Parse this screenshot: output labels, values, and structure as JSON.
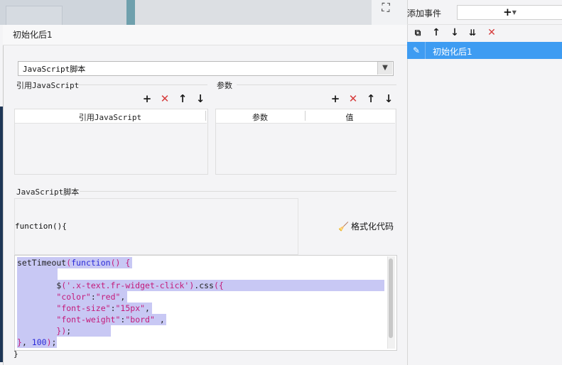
{
  "dialog": {
    "title": "初始化后1",
    "script_type_select": {
      "value": "JavaScript脚本"
    },
    "referenced_js": {
      "section_label": "引用JavaScript",
      "column_header": "引用JavaScript"
    },
    "params": {
      "section_label": "参数",
      "columns": [
        "参数",
        "值"
      ]
    },
    "js_section_label": "JavaScript脚本",
    "function_header": "function(){",
    "format_button_label": "格式化代码",
    "code_lines": [
      "setTimeout(function() {",
      "",
      "        $('.x-text.fr-widget-click').css({",
      "        \"color\":\"red\",",
      "        \"font-size\":\"15px\",",
      "        \"font-weight\":\"bord\" ,",
      "        });",
      "}, 100);"
    ],
    "closing_brace": "}"
  },
  "right_panel": {
    "title": "添加事件",
    "events": [
      {
        "label": "初始化后1",
        "selected": true
      }
    ]
  },
  "icons": {
    "add": "plus-icon",
    "delete": "delete-x-icon",
    "move_up": "arrow-up-icon",
    "move_down": "arrow-down-icon",
    "copy": "copy-icon",
    "move_bottom": "move-to-bottom-icon",
    "edit": "pencil-icon",
    "format": "broom-icon",
    "crop": "crop-icon"
  },
  "colors": {
    "selection_blue": "#3e9cf2",
    "delete_red": "#d63a3a",
    "code_selection": "#c8c8f4",
    "string_magenta": "#c41a7a",
    "keyword_blue": "#2a2ad8"
  }
}
